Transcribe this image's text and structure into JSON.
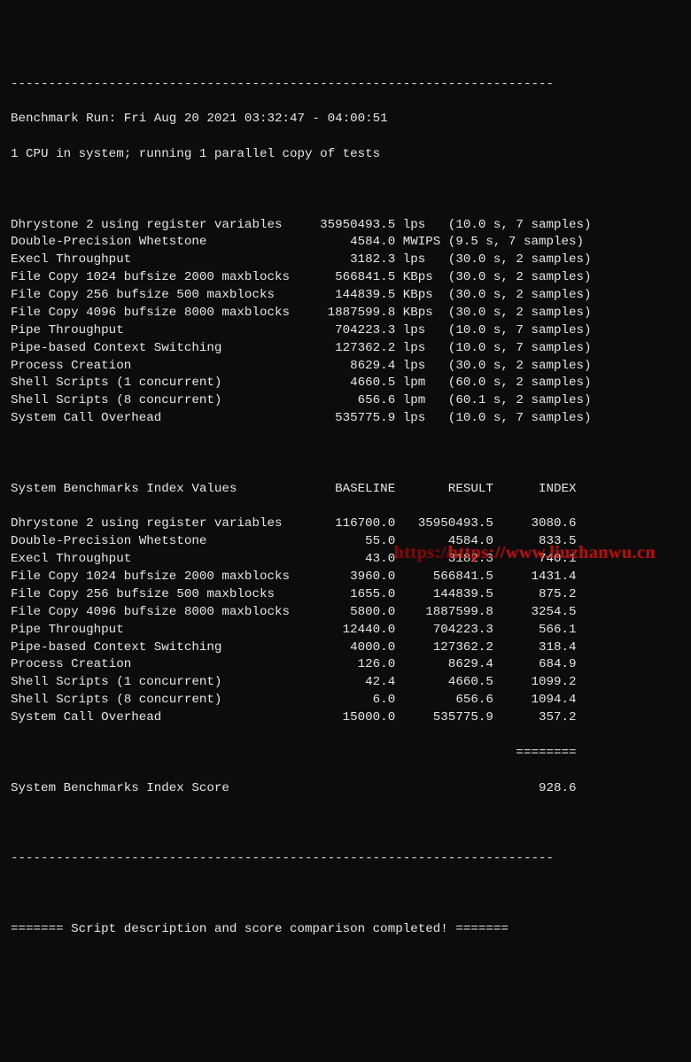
{
  "header": {
    "sep_top": "------------------------------------------------------------------------",
    "run_line": "Benchmark Run: Fri Aug 20 2021 03:32:47 - 04:00:51",
    "cpu_line": "1 CPU in system; running 1 parallel copy of tests"
  },
  "tests": [
    {
      "name": "Dhrystone 2 using register variables",
      "value": "35950493.5",
      "unit": "lps",
      "timing": "(10.0 s, 7 samples)"
    },
    {
      "name": "Double-Precision Whetstone",
      "value": "4584.0",
      "unit": "MWIPS",
      "timing": "(9.5 s, 7 samples)"
    },
    {
      "name": "Execl Throughput",
      "value": "3182.3",
      "unit": "lps",
      "timing": "(30.0 s, 2 samples)"
    },
    {
      "name": "File Copy 1024 bufsize 2000 maxblocks",
      "value": "566841.5",
      "unit": "KBps",
      "timing": "(30.0 s, 2 samples)"
    },
    {
      "name": "File Copy 256 bufsize 500 maxblocks",
      "value": "144839.5",
      "unit": "KBps",
      "timing": "(30.0 s, 2 samples)"
    },
    {
      "name": "File Copy 4096 bufsize 8000 maxblocks",
      "value": "1887599.8",
      "unit": "KBps",
      "timing": "(30.0 s, 2 samples)"
    },
    {
      "name": "Pipe Throughput",
      "value": "704223.3",
      "unit": "lps",
      "timing": "(10.0 s, 7 samples)"
    },
    {
      "name": "Pipe-based Context Switching",
      "value": "127362.2",
      "unit": "lps",
      "timing": "(10.0 s, 7 samples)"
    },
    {
      "name": "Process Creation",
      "value": "8629.4",
      "unit": "lps",
      "timing": "(30.0 s, 2 samples)"
    },
    {
      "name": "Shell Scripts (1 concurrent)",
      "value": "4660.5",
      "unit": "lpm",
      "timing": "(60.0 s, 2 samples)"
    },
    {
      "name": "Shell Scripts (8 concurrent)",
      "value": "656.6",
      "unit": "lpm",
      "timing": "(60.1 s, 2 samples)"
    },
    {
      "name": "System Call Overhead",
      "value": "535775.9",
      "unit": "lps",
      "timing": "(10.0 s, 7 samples)"
    }
  ],
  "index_header": {
    "title": "System Benchmarks Index Values",
    "col_baseline": "BASELINE",
    "col_result": "RESULT",
    "col_index": "INDEX"
  },
  "index_rows": [
    {
      "name": "Dhrystone 2 using register variables",
      "baseline": "116700.0",
      "result": "35950493.5",
      "index": "3080.6"
    },
    {
      "name": "Double-Precision Whetstone",
      "baseline": "55.0",
      "result": "4584.0",
      "index": "833.5"
    },
    {
      "name": "Execl Throughput",
      "baseline": "43.0",
      "result": "3182.3",
      "index": "740.1"
    },
    {
      "name": "File Copy 1024 bufsize 2000 maxblocks",
      "baseline": "3960.0",
      "result": "566841.5",
      "index": "1431.4"
    },
    {
      "name": "File Copy 256 bufsize 500 maxblocks",
      "baseline": "1655.0",
      "result": "144839.5",
      "index": "875.2"
    },
    {
      "name": "File Copy 4096 bufsize 8000 maxblocks",
      "baseline": "5800.0",
      "result": "1887599.8",
      "index": "3254.5"
    },
    {
      "name": "Pipe Throughput",
      "baseline": "12440.0",
      "result": "704223.3",
      "index": "566.1"
    },
    {
      "name": "Pipe-based Context Switching",
      "baseline": "4000.0",
      "result": "127362.2",
      "index": "318.4"
    },
    {
      "name": "Process Creation",
      "baseline": "126.0",
      "result": "8629.4",
      "index": "684.9"
    },
    {
      "name": "Shell Scripts (1 concurrent)",
      "baseline": "42.4",
      "result": "4660.5",
      "index": "1099.2"
    },
    {
      "name": "Shell Scripts (8 concurrent)",
      "baseline": "6.0",
      "result": "656.6",
      "index": "1094.4"
    },
    {
      "name": "System Call Overhead",
      "baseline": "15000.0",
      "result": "535775.9",
      "index": "357.2"
    }
  ],
  "score": {
    "sep": "                                                                   ========",
    "label": "System Benchmarks Index Score",
    "value": "928.6"
  },
  "footer": {
    "sep_before": "------------------------------------------------------------------------",
    "line": "======= Script description and score comparison completed! ======="
  },
  "watermark": {
    "ghost": "https://",
    "text": "https://www.liuzhanwu.cn"
  }
}
